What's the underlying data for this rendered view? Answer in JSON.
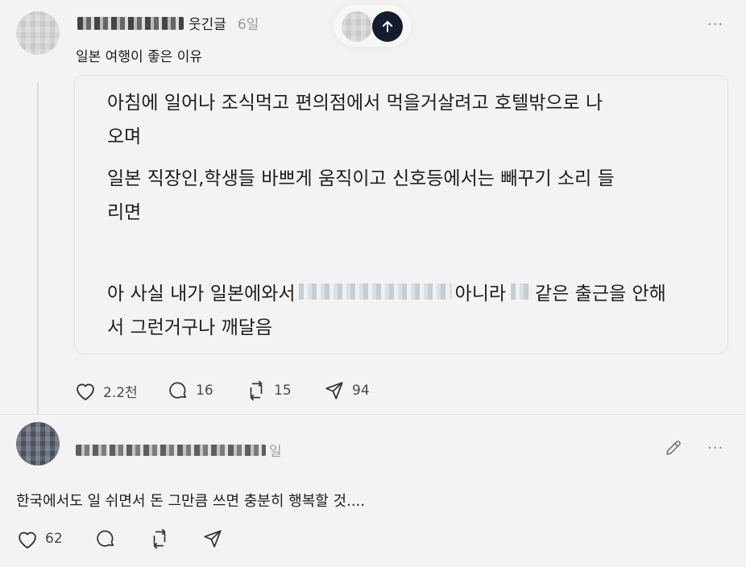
{
  "post": {
    "author_suffix": "웃긴글",
    "time": "6일",
    "title": "일본 여행이 좋은 이유",
    "quote_lines": [
      "아침에 일어나  조식먹고 편의점에서 먹을거살려고  호텔밖으로 나",
      "오며",
      "일본 직장인,학생들 바쁘게 움직이고 신호등에서는 빼꾸기 소리 들",
      "리면",
      "아 사실 내가 일본에와서",
      "아니라",
      "같은 출근을 안해",
      "서 그런거구나 깨달음"
    ],
    "likes": "2.2천",
    "comments": "16",
    "reposts": "15",
    "shares": "94"
  },
  "reply": {
    "time_suffix": "일",
    "text": "한국에서도 일 쉬면서 돈 그만큼 쓰면 충분히 행복할 것....",
    "likes": "62"
  },
  "ui": {
    "more": "···",
    "accent": "#141c2e"
  },
  "icons": [
    "heart-icon",
    "comment-icon",
    "repost-icon",
    "share-icon",
    "arrow-up-icon",
    "pencil-icon",
    "more-icon"
  ]
}
